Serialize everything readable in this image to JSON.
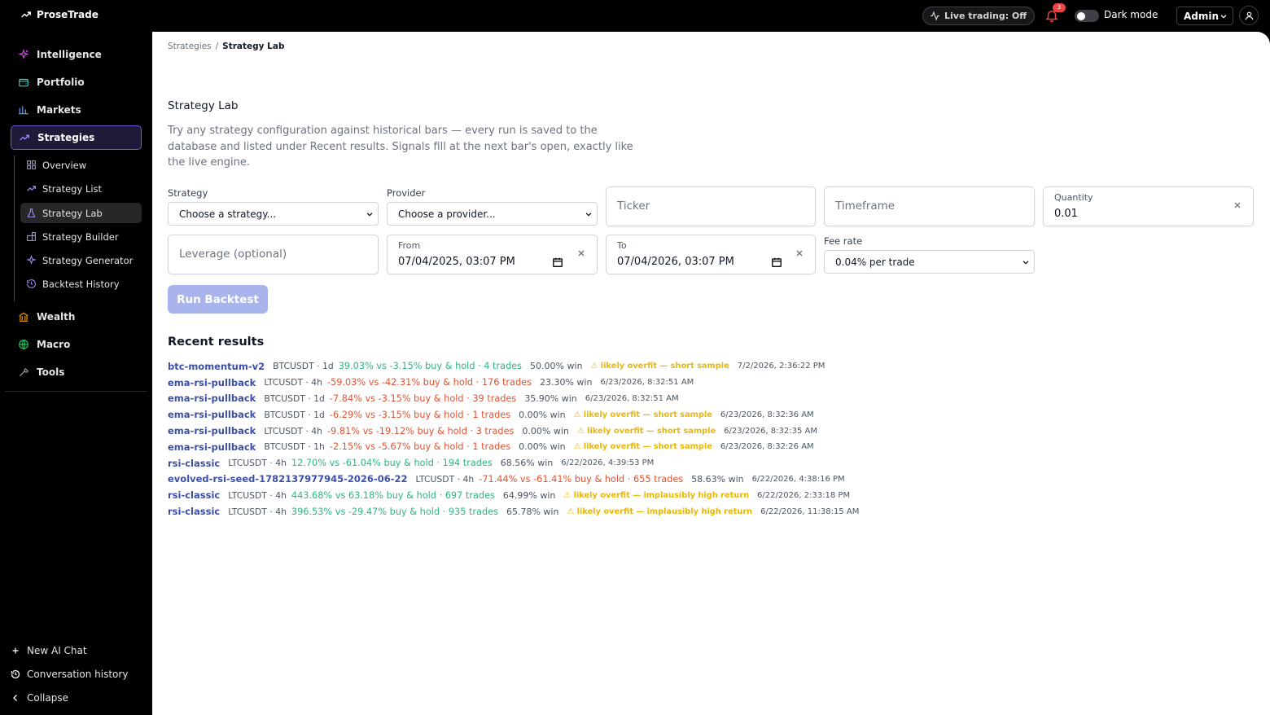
{
  "app": {
    "name": "ProseTrade"
  },
  "header": {
    "live_trading": "Live trading: Off",
    "notifications_count": "3",
    "dark_mode_label": "Dark mode",
    "account_label": "Admin"
  },
  "sidebar": {
    "items": [
      {
        "label": "Intelligence",
        "icon": "sparkles-icon"
      },
      {
        "label": "Portfolio",
        "icon": "wallet-icon"
      },
      {
        "label": "Markets",
        "icon": "bar-chart-icon"
      },
      {
        "label": "Strategies",
        "icon": "trend-up-icon"
      }
    ],
    "sub_items": [
      {
        "label": "Overview",
        "icon": "grid-icon"
      },
      {
        "label": "Strategy List",
        "icon": "trend-up-icon"
      },
      {
        "label": "Strategy Lab",
        "icon": "flask-icon"
      },
      {
        "label": "Strategy Builder",
        "icon": "blocks-icon"
      },
      {
        "label": "Strategy Generator",
        "icon": "sparkle-icon"
      },
      {
        "label": "Backtest History",
        "icon": "history-icon"
      }
    ],
    "more_items": [
      {
        "label": "Wealth",
        "icon": "bank-icon"
      },
      {
        "label": "Macro",
        "icon": "globe-icon"
      },
      {
        "label": "Tools",
        "icon": "wrench-icon"
      }
    ],
    "footer": {
      "new_chat": "New AI Chat",
      "history": "Conversation history",
      "collapse": "Collapse"
    }
  },
  "breadcrumb": {
    "parent": "Strategies",
    "current": "Strategy Lab"
  },
  "page": {
    "title": "Strategy Lab",
    "description": "Try any strategy configuration against historical bars — every run is saved to the database and listed under Recent results. Signals fill at the next bar's open, exactly like the live engine."
  },
  "form": {
    "strategy": {
      "label": "Strategy",
      "value": "Choose a strategy..."
    },
    "provider": {
      "label": "Provider",
      "value": "Choose a provider..."
    },
    "ticker": {
      "placeholder": "Ticker"
    },
    "timeframe": {
      "placeholder": "Timeframe"
    },
    "quantity": {
      "label": "Quantity",
      "value": "0.01"
    },
    "leverage": {
      "placeholder": "Leverage (optional)"
    },
    "from": {
      "label": "From",
      "value": "07/04/2025, 03:07 PM"
    },
    "to": {
      "label": "To",
      "value": "07/04/2026, 03:07 PM"
    },
    "fee_rate": {
      "label": "Fee rate",
      "value": "0.04% per trade"
    },
    "run_button": "Run Backtest"
  },
  "recent": {
    "title": "Recent results",
    "rows": [
      {
        "name": "btc-momentum-v2",
        "meta": "BTCUSDT · 1d",
        "ret": "39.03% vs -3.15% buy & hold · 4 trades",
        "pos": true,
        "win": "50.00% win",
        "warn": "⚠ likely overfit — short sample",
        "ts": "7/2/2026, 2:36:22 PM"
      },
      {
        "name": "ema-rsi-pullback",
        "meta": "LTCUSDT · 4h",
        "ret": "-59.03% vs -42.31% buy & hold · 176 trades",
        "pos": false,
        "win": "23.30% win",
        "warn": "",
        "ts": "6/23/2026, 8:32:51 AM"
      },
      {
        "name": "ema-rsi-pullback",
        "meta": "BTCUSDT · 1d",
        "ret": "-7.84% vs -3.15% buy & hold · 39 trades",
        "pos": false,
        "win": "35.90% win",
        "warn": "",
        "ts": "6/23/2026, 8:32:51 AM"
      },
      {
        "name": "ema-rsi-pullback",
        "meta": "BTCUSDT · 1d",
        "ret": "-6.29% vs -3.15% buy & hold · 1 trades",
        "pos": false,
        "win": "0.00% win",
        "warn": "⚠ likely overfit — short sample",
        "ts": "6/23/2026, 8:32:36 AM"
      },
      {
        "name": "ema-rsi-pullback",
        "meta": "LTCUSDT · 4h",
        "ret": "-9.81% vs -19.12% buy & hold · 3 trades",
        "pos": false,
        "win": "0.00% win",
        "warn": "⚠ likely overfit — short sample",
        "ts": "6/23/2026, 8:32:35 AM"
      },
      {
        "name": "ema-rsi-pullback",
        "meta": "BTCUSDT · 1h",
        "ret": "-2.15% vs -5.67% buy & hold · 1 trades",
        "pos": false,
        "win": "0.00% win",
        "warn": "⚠ likely overfit — short sample",
        "ts": "6/23/2026, 8:32:26 AM"
      },
      {
        "name": "rsi-classic",
        "meta": "LTCUSDT · 4h",
        "ret": "12.70% vs -61.04% buy & hold · 194 trades",
        "pos": true,
        "win": "68.56% win",
        "warn": "",
        "ts": "6/22/2026, 4:39:53 PM"
      },
      {
        "name": "evolved-rsi-seed-1782137977945-2026-06-22",
        "meta": "LTCUSDT · 4h",
        "ret": "-71.44% vs -61.41% buy & hold · 655 trades",
        "pos": false,
        "win": "58.63% win",
        "warn": "",
        "ts": "6/22/2026, 4:38:16 PM"
      },
      {
        "name": "rsi-classic",
        "meta": "LTCUSDT · 4h",
        "ret": "443.68% vs 63.18% buy & hold · 697 trades",
        "pos": true,
        "win": "64.99% win",
        "warn": "⚠ likely overfit — implausibly high return",
        "ts": "6/22/2026, 2:33:18 PM"
      },
      {
        "name": "rsi-classic",
        "meta": "LTCUSDT · 4h",
        "ret": "396.53% vs -29.47% buy & hold · 935 trades",
        "pos": true,
        "win": "65.78% win",
        "warn": "⚠ likely overfit — implausibly high return",
        "ts": "6/22/2026, 11:38:15 AM"
      }
    ]
  },
  "colors": {
    "accent": "#6d5bd0",
    "positive": "#2fb57f",
    "negative": "#e2522f",
    "warning": "#e8b70c",
    "link": "#3b4fa8"
  }
}
